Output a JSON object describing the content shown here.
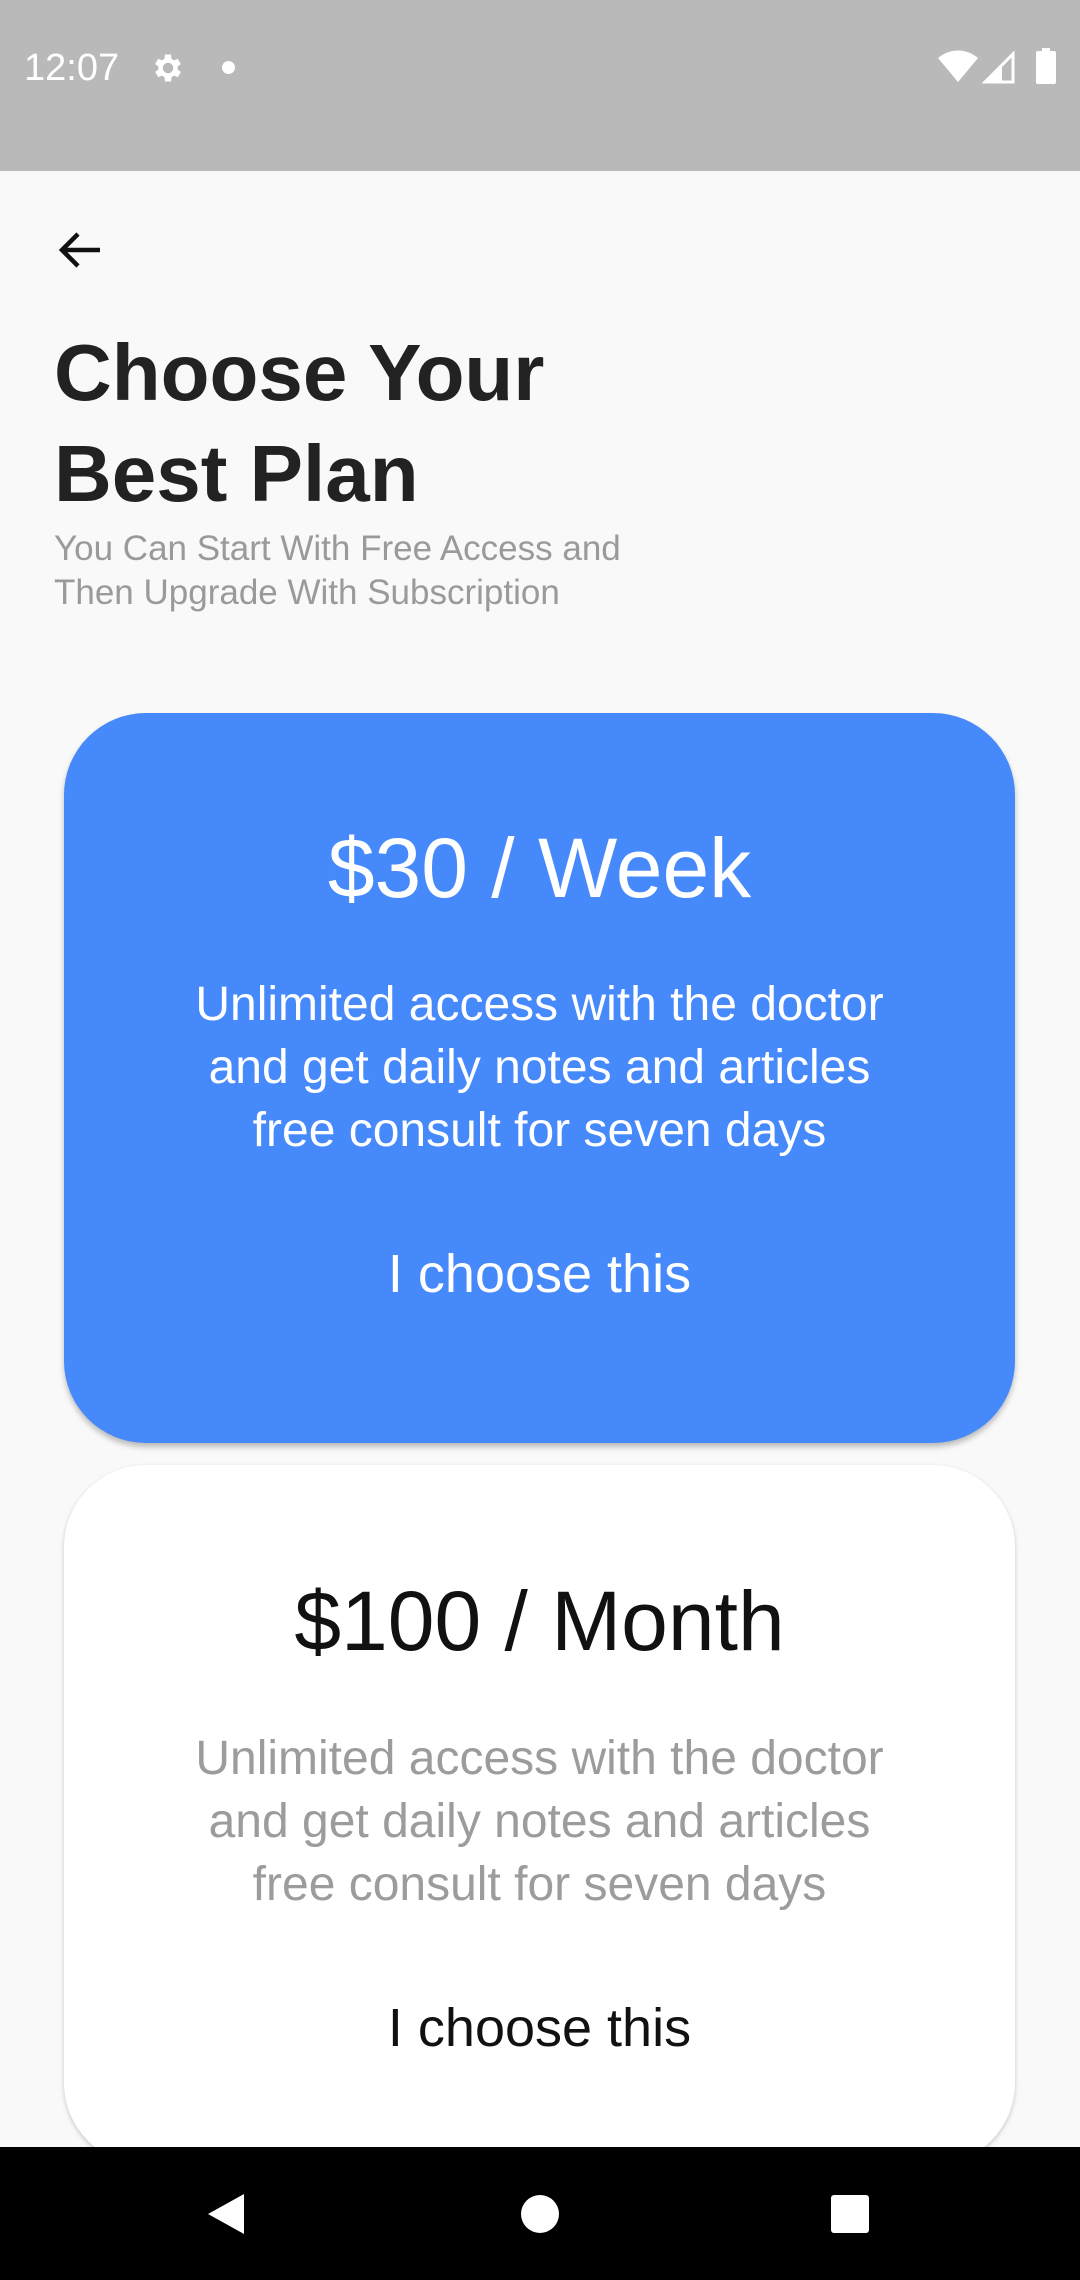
{
  "status_bar": {
    "time": "12:07",
    "icons": [
      "settings-gear-icon",
      "notification-dot-icon",
      "wifi-icon",
      "cell-signal-icon",
      "battery-icon"
    ]
  },
  "header": {
    "back_icon": "arrow-left-icon",
    "title_line1": "Choose Your",
    "title_line2": "Best Plan",
    "subtitle_line1": "You Can Start With Free Access and",
    "subtitle_line2": "Then Upgrade With Subscription"
  },
  "plans": [
    {
      "price": "$30 / Week",
      "description_line1": "Unlimited access with the doctor",
      "description_line2": "and get daily notes and articles",
      "description_line3": "free consult for seven days",
      "action": "I choose this",
      "selected": true
    },
    {
      "price": "$100 / Month",
      "description_line1": "Unlimited access with the doctor",
      "description_line2": "and get daily notes and articles",
      "description_line3": "free consult for seven days",
      "action": "I choose this",
      "selected": false
    }
  ],
  "nav_bar": {
    "icons": [
      "nav-back-icon",
      "nav-home-icon",
      "nav-recents-icon"
    ]
  },
  "colors": {
    "accent": "#4589fb",
    "status_bar": "#b9b9b9",
    "background": "#f9f9f9"
  }
}
